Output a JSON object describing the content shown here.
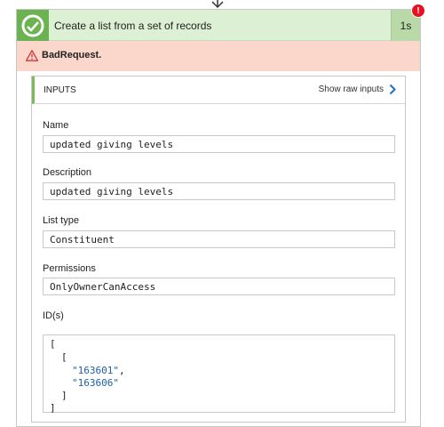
{
  "step": {
    "title": "Create a list from a set of records",
    "duration": "1s",
    "error_badge": "!",
    "status_color": "#6bb350"
  },
  "error": {
    "message": "BadRequest.",
    "icon": "warning-icon",
    "color": "#fbd6cb"
  },
  "inputs": {
    "title": "INPUTS",
    "show_raw_label": "Show raw inputs",
    "fields": [
      {
        "label": "Name",
        "value": "updated giving levels"
      },
      {
        "label": "Description",
        "value": "updated giving levels"
      },
      {
        "label": "List type",
        "value": "Constituent"
      },
      {
        "label": "Permissions",
        "value": "OnlyOwnerCanAccess"
      }
    ],
    "ids": {
      "label": "ID(s)",
      "open_outer": "[",
      "open_inner": "[",
      "item_1": "\"163601\"",
      "item_1_sep": ",",
      "item_2": "\"163606\"",
      "close_inner": "]",
      "close_outer": "]"
    }
  }
}
